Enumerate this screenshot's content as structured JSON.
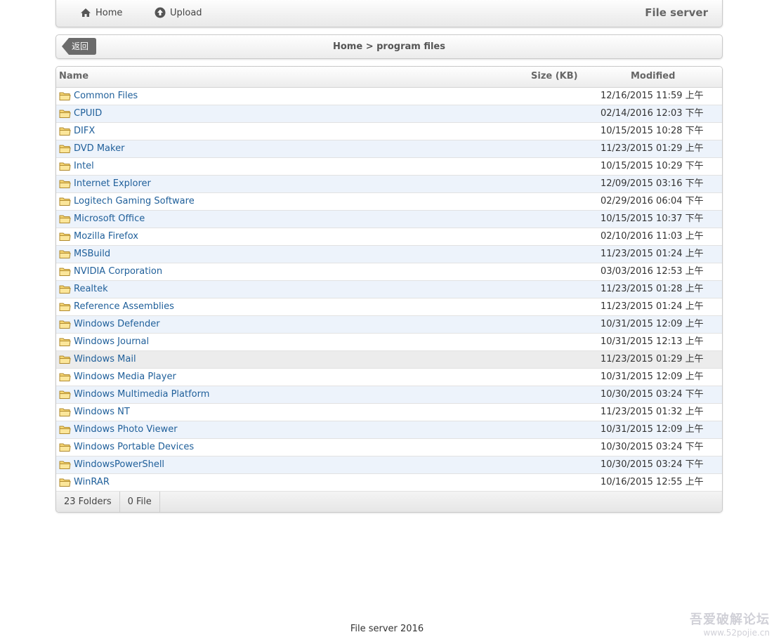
{
  "nav": {
    "home_label": "Home",
    "upload_label": "Upload",
    "brand": "File server",
    "home_icon": "home-icon",
    "upload_icon": "upload-icon"
  },
  "breadcrumb": {
    "back_label": "返回",
    "path": "Home > program files"
  },
  "table": {
    "columns": {
      "name": "Name",
      "size": "Size (KB)",
      "modified": "Modified"
    },
    "rows": [
      {
        "name": "Common Files",
        "modified": "12/16/2015 11:59 上午"
      },
      {
        "name": "CPUID",
        "modified": "02/14/2016 12:03 下午"
      },
      {
        "name": "DIFX",
        "modified": "10/15/2015 10:28 下午"
      },
      {
        "name": "DVD Maker",
        "modified": "11/23/2015 01:29 上午"
      },
      {
        "name": "Intel",
        "modified": "10/15/2015 10:29 下午"
      },
      {
        "name": "Internet Explorer",
        "modified": "12/09/2015 03:16 下午"
      },
      {
        "name": "Logitech Gaming Software",
        "modified": "02/29/2016 06:04 下午"
      },
      {
        "name": "Microsoft Office",
        "modified": "10/15/2015 10:37 下午"
      },
      {
        "name": "Mozilla Firefox",
        "modified": "02/10/2016 11:03 上午"
      },
      {
        "name": "MSBuild",
        "modified": "11/23/2015 01:24 上午"
      },
      {
        "name": "NVIDIA Corporation",
        "modified": "03/03/2016 12:53 上午"
      },
      {
        "name": "Realtek",
        "modified": "11/23/2015 01:28 上午"
      },
      {
        "name": "Reference Assemblies",
        "modified": "11/23/2015 01:24 上午"
      },
      {
        "name": "Windows Defender",
        "modified": "10/31/2015 12:09 上午"
      },
      {
        "name": "Windows Journal",
        "modified": "10/31/2015 12:13 上午"
      },
      {
        "name": "Windows Mail",
        "modified": "11/23/2015 01:29 上午"
      },
      {
        "name": "Windows Media Player",
        "modified": "10/31/2015 12:09 上午"
      },
      {
        "name": "Windows Multimedia Platform",
        "modified": "10/30/2015 03:24 下午"
      },
      {
        "name": "Windows NT",
        "modified": "11/23/2015 01:32 上午"
      },
      {
        "name": "Windows Photo Viewer",
        "modified": "10/31/2015 12:09 上午"
      },
      {
        "name": "Windows Portable Devices",
        "modified": "10/30/2015 03:24 下午"
      },
      {
        "name": "WindowsPowerShell",
        "modified": "10/30/2015 03:24 下午"
      },
      {
        "name": "WinRAR",
        "modified": "10/16/2015 12:55 上午"
      }
    ],
    "hover_row_index": 15,
    "folder_icon": "folder-icon"
  },
  "summary": {
    "folders": "23 Folders",
    "files": "0 File"
  },
  "footer": {
    "copyright": "File server 2016"
  },
  "watermark": {
    "line1": "吾爱破解论坛",
    "line2": "www.52pojie.cn"
  },
  "colors": {
    "link": "#1f5f9a",
    "alt_row": "#edf3fb",
    "back_button": "#6b6b6b"
  }
}
